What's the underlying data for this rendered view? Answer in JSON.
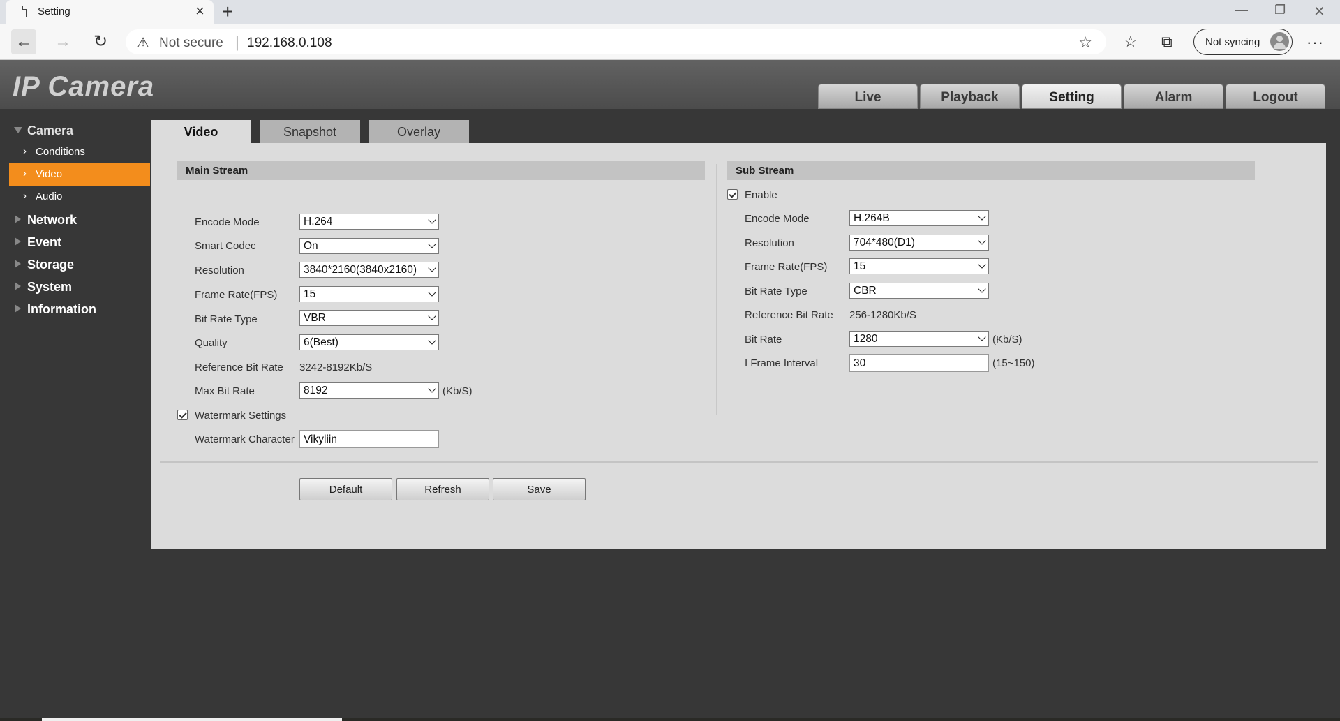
{
  "browser": {
    "tab_title": "Setting",
    "not_secure": "Not secure",
    "url": "192.168.0.108",
    "sync_label": "Not syncing"
  },
  "app": {
    "logo": "IP Camera",
    "nav": [
      "Live",
      "Playback",
      "Setting",
      "Alarm",
      "Logout"
    ],
    "active_nav": "Setting"
  },
  "sidebar": {
    "groups": [
      {
        "label": "Camera",
        "expanded": true,
        "items": [
          {
            "label": "Conditions"
          },
          {
            "label": "Video",
            "active": true
          },
          {
            "label": "Audio"
          }
        ]
      },
      {
        "label": "Network"
      },
      {
        "label": "Event"
      },
      {
        "label": "Storage"
      },
      {
        "label": "System"
      },
      {
        "label": "Information"
      }
    ]
  },
  "tabs": [
    "Video",
    "Snapshot",
    "Overlay"
  ],
  "main_stream": {
    "title": "Main Stream",
    "encode_mode_label": "Encode Mode",
    "encode_mode": "H.264",
    "smart_codec_label": "Smart Codec",
    "smart_codec": "On",
    "resolution_label": "Resolution",
    "resolution": "3840*2160(3840x2160)",
    "frame_rate_label": "Frame Rate(FPS)",
    "frame_rate": "15",
    "bit_rate_type_label": "Bit Rate Type",
    "bit_rate_type": "VBR",
    "quality_label": "Quality",
    "quality": "6(Best)",
    "ref_bit_rate_label": "Reference Bit Rate",
    "ref_bit_rate": "3242-8192Kb/S",
    "max_bit_rate_label": "Max Bit Rate",
    "max_bit_rate": "8192",
    "max_bit_rate_unit": "(Kb/S)",
    "watermark_settings_label": "Watermark Settings",
    "watermark_enabled": true,
    "watermark_char_label": "Watermark Character",
    "watermark_char": "Vikyliin"
  },
  "sub_stream": {
    "title": "Sub Stream",
    "enable_label": "Enable",
    "enabled": true,
    "encode_mode_label": "Encode Mode",
    "encode_mode": "H.264B",
    "resolution_label": "Resolution",
    "resolution": "704*480(D1)",
    "frame_rate_label": "Frame Rate(FPS)",
    "frame_rate": "15",
    "bit_rate_type_label": "Bit Rate Type",
    "bit_rate_type": "CBR",
    "ref_bit_rate_label": "Reference Bit Rate",
    "ref_bit_rate": "256-1280Kb/S",
    "bit_rate_label": "Bit Rate",
    "bit_rate": "1280",
    "bit_rate_unit": "(Kb/S)",
    "iframe_label": "I Frame Interval",
    "iframe": "30",
    "iframe_range": "(15~150)"
  },
  "buttons": {
    "default": "Default",
    "refresh": "Refresh",
    "save": "Save"
  },
  "colors": {
    "accent": "#f38d1c",
    "background": "#373737",
    "panel": "#dcdcdc"
  }
}
